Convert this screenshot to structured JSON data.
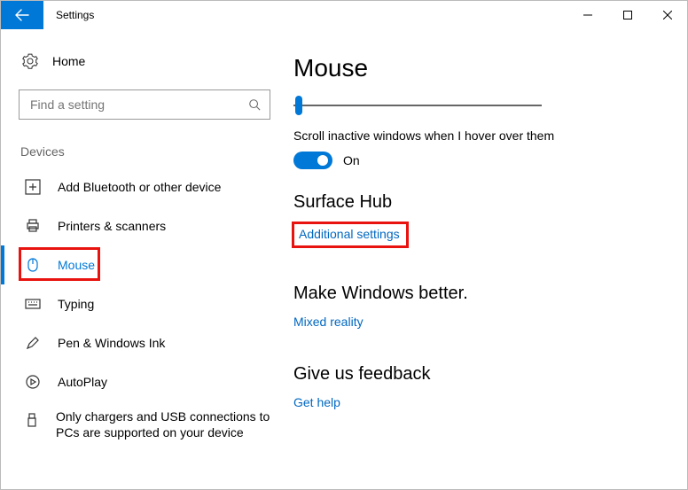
{
  "window": {
    "title": "Settings"
  },
  "sidebar": {
    "home": "Home",
    "search_placeholder": "Find a setting",
    "section": "Devices",
    "items": [
      {
        "label": "Add Bluetooth or other device"
      },
      {
        "label": "Printers & scanners"
      },
      {
        "label": "Mouse"
      },
      {
        "label": "Typing"
      },
      {
        "label": "Pen & Windows Ink"
      },
      {
        "label": "AutoPlay"
      },
      {
        "label": "Only chargers and USB connections to PCs are supported on your device"
      }
    ]
  },
  "main": {
    "title": "Mouse",
    "scroll_inactive_label": "Scroll inactive windows when I hover over them",
    "toggle_state": "On",
    "surface_hub_heading": "Surface Hub",
    "additional_settings": "Additional settings",
    "make_better_heading": "Make Windows better.",
    "mixed_reality": "Mixed reality",
    "feedback_heading": "Give us feedback",
    "get_help": "Get help"
  }
}
